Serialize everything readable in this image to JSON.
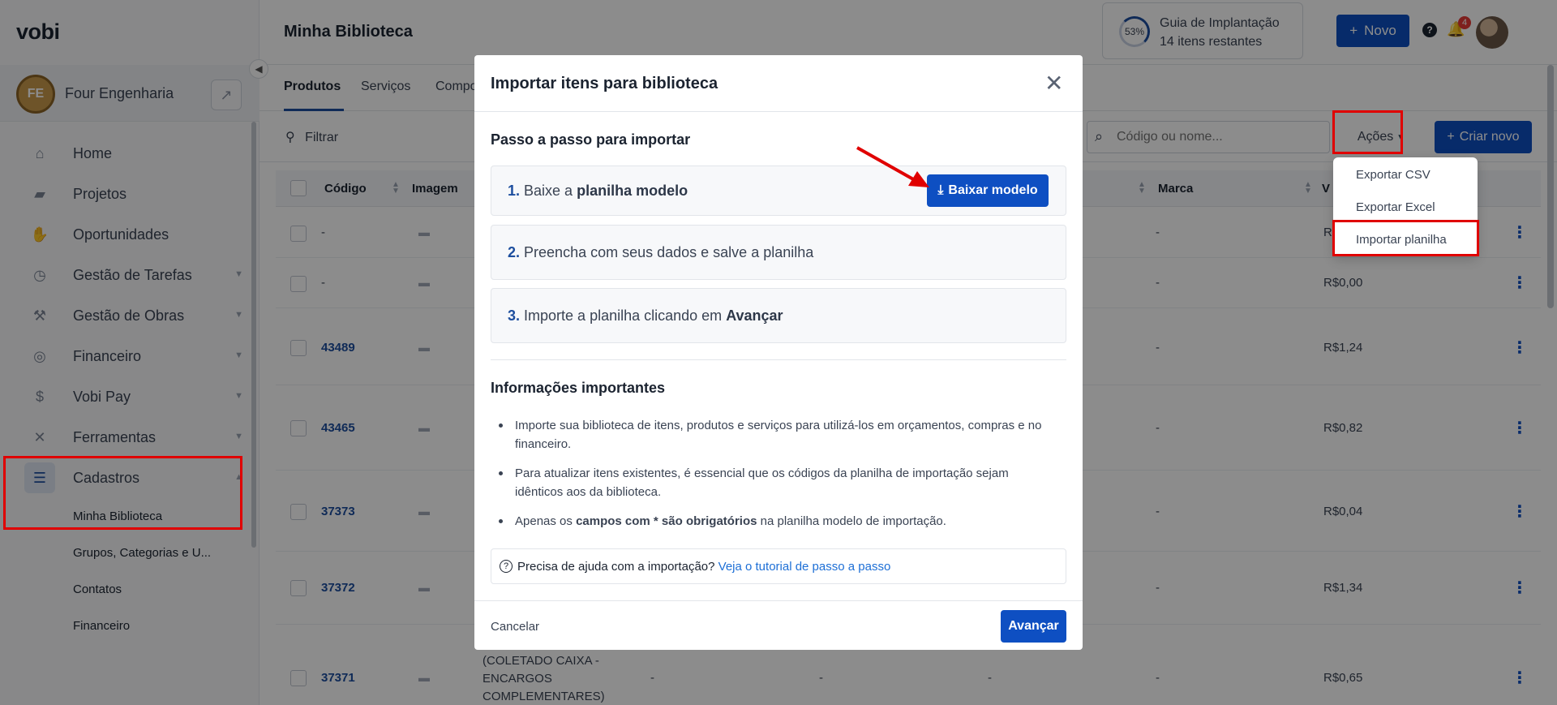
{
  "brand": {
    "logo": "vobi"
  },
  "company": {
    "initials": "FE",
    "name": "Four Engenharia"
  },
  "sidebar": {
    "items": [
      {
        "label": "Home",
        "icon": "home-icon"
      },
      {
        "label": "Projetos",
        "icon": "folder-icon"
      },
      {
        "label": "Oportunidades",
        "icon": "handshake-icon"
      },
      {
        "label": "Gestão de Tarefas",
        "icon": "clock-icon"
      },
      {
        "label": "Gestão de Obras",
        "icon": "worker-icon"
      },
      {
        "label": "Financeiro",
        "icon": "coins-icon"
      },
      {
        "label": "Vobi Pay",
        "icon": "dollar-icon"
      },
      {
        "label": "Ferramentas",
        "icon": "tools-icon"
      },
      {
        "label": "Cadastros",
        "icon": "list-icon"
      }
    ],
    "sub_items": [
      "Minha Biblioteca",
      "Grupos, Categorias e U...",
      "Contatos",
      "Financeiro"
    ]
  },
  "header": {
    "title": "Minha Biblioteca",
    "guide_percent": "53%",
    "guide_title": "Guia de Implantação",
    "guide_remaining": "14 itens restantes",
    "novo_label": "Novo",
    "notif_count": "4"
  },
  "tabs": [
    "Produtos",
    "Serviços",
    "Compo"
  ],
  "toolbar": {
    "filter_label": "Filtrar",
    "search_placeholder": "Código ou nome...",
    "actions_label": "Ações",
    "create_label": "Criar novo"
  },
  "table": {
    "headers": [
      "Código",
      "Imagem",
      "Marca",
      "V"
    ],
    "rows": [
      {
        "code": "-",
        "marca": "-",
        "valor": "R"
      },
      {
        "code": "-",
        "marca": "-",
        "valor": "R$0,00"
      },
      {
        "code": "43489",
        "marca": "-",
        "valor": "R$1,24"
      },
      {
        "code": "43465",
        "marca": "-",
        "valor": "R$0,82"
      },
      {
        "code": "37373",
        "marca": "-",
        "valor": "R$0,04"
      },
      {
        "code": "37372",
        "marca": "-",
        "valor": "R$1,34"
      },
      {
        "code": "37371",
        "marca": "-",
        "valor": "R$0,65"
      }
    ],
    "last_row_desc": [
      "(COLETADO CAIXA -",
      "ENCARGOS",
      "COMPLEMENTARES)"
    ],
    "last_row_dashes": [
      "-",
      "-",
      "-"
    ]
  },
  "dropdown": {
    "items": [
      "Exportar CSV",
      "Exportar Excel",
      "Importar planilha"
    ]
  },
  "modal": {
    "title": "Importar itens para biblioteca",
    "steps_title": "Passo a passo para importar",
    "step1": {
      "num": "1.",
      "text": "Baixe a",
      "bold": "planilha modelo"
    },
    "download_label": "Baixar modelo",
    "step2": {
      "num": "2.",
      "text": "Preencha com seus dados e salve a planilha"
    },
    "step3": {
      "num": "3.",
      "text": "Importe a planilha clicando em",
      "bold": "Avançar"
    },
    "info_title": "Informações importantes",
    "bullet1": "Importe sua biblioteca de itens, produtos e serviços para utilizá-los em orçamentos, compras e no financeiro.",
    "bullet2": "Para atualizar itens existentes, é essencial que os códigos da planilha de importação sejam idênticos aos da biblioteca.",
    "bullet3_pre": "Apenas os",
    "bullet3_bold": "campos com * são obrigatórios",
    "bullet3_post": "na planilha modelo de importação.",
    "help_text": "Precisa de ajuda com a importação?",
    "help_link": "Veja o tutorial de passo a passo",
    "cancel_label": "Cancelar",
    "next_label": "Avançar"
  }
}
